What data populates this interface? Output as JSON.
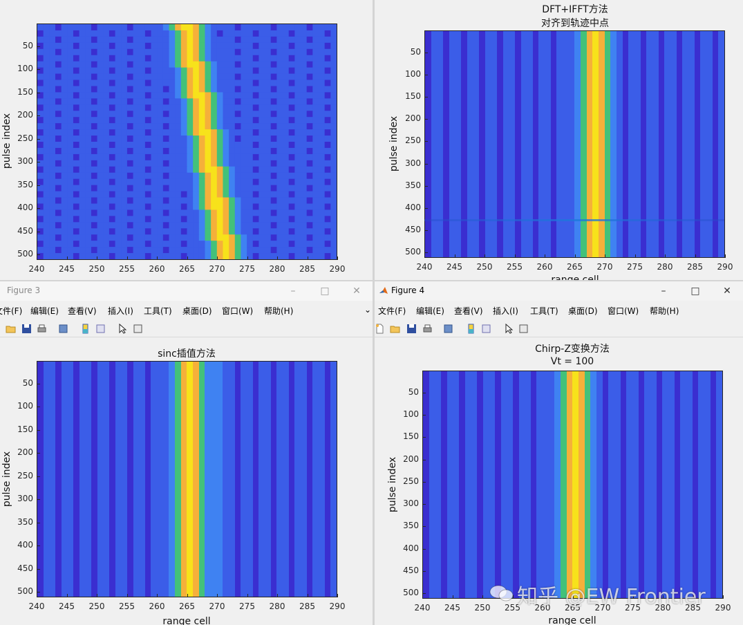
{
  "windows": {
    "fig1": {
      "title": "",
      "menu": []
    },
    "fig2": {
      "title": "",
      "menu": []
    },
    "fig3": {
      "title": "Figure 3",
      "menu": [
        "文件(F)",
        "编辑(E)",
        "查看(V)",
        "插入(I)",
        "工具(T)",
        "桌面(D)",
        "窗口(W)",
        "帮助(H)"
      ]
    },
    "fig4": {
      "title": "Figure 4",
      "menu": [
        "文件(F)",
        "编辑(E)",
        "查看(V)",
        "插入(I)",
        "工具(T)",
        "桌面(D)",
        "窗口(W)",
        "帮助(H)"
      ]
    }
  },
  "watermark": "知乎 @EW Frontier",
  "colors": {
    "dark_blue": "#3a2ed0",
    "blue": "#3b5de8",
    "light_blue": "#3f82f2",
    "cyan": "#1fb6c9",
    "green": "#43c17a",
    "yellow_green": "#a9c93a",
    "orange": "#f5b03a",
    "yellow": "#f7e21b"
  },
  "chart_data": [
    {
      "type": "heatmap",
      "id": "fig1",
      "title": "",
      "subtitle": "",
      "xlabel": "",
      "ylabel": "pulse index",
      "xlim": [
        240,
        290
      ],
      "ylim": [
        512,
        1
      ],
      "xticks": [
        "240",
        "245",
        "250",
        "255",
        "260",
        "265",
        "270",
        "275",
        "280",
        "285",
        "290"
      ],
      "yticks": [
        "50",
        "100",
        "150",
        "200",
        "250",
        "300",
        "350",
        "400",
        "450",
        "500"
      ],
      "peak_range_cell_start": 265,
      "peak_range_cell_end": 271.5
    },
    {
      "type": "heatmap",
      "id": "fig2",
      "title": "DFT+IFFT方法",
      "subtitle": "对齐到轨迹中点",
      "xlabel": "range cell",
      "ylabel": "pulse index",
      "xlim": [
        240,
        290
      ],
      "ylim": [
        512,
        1
      ],
      "xticks": [
        "240",
        "245",
        "250",
        "255",
        "260",
        "265",
        "270",
        "275",
        "280",
        "285",
        "290"
      ],
      "yticks": [
        "50",
        "100",
        "150",
        "200",
        "250",
        "300",
        "350",
        "400",
        "450",
        "500"
      ],
      "peak_range_cell": 268
    },
    {
      "type": "heatmap",
      "id": "fig3",
      "title": "sinc插值方法",
      "subtitle": "",
      "xlabel": "range cell",
      "ylabel": "pulse index",
      "xlim": [
        240,
        290
      ],
      "ylim": [
        512,
        1
      ],
      "xticks": [
        "240",
        "245",
        "250",
        "255",
        "260",
        "265",
        "270",
        "275",
        "280",
        "285",
        "290"
      ],
      "yticks": [
        "50",
        "100",
        "150",
        "200",
        "250",
        "300",
        "350",
        "400",
        "450",
        "500"
      ],
      "peak_range_cell": 265
    },
    {
      "type": "heatmap",
      "id": "fig4",
      "title": "Chirp-Z变换方法",
      "subtitle": "Vt = 100",
      "xlabel": "range cell",
      "ylabel": "pulse index",
      "xlim": [
        240,
        290
      ],
      "ylim": [
        512,
        1
      ],
      "xticks": [
        "240",
        "245",
        "250",
        "255",
        "260",
        "265",
        "270",
        "275",
        "280",
        "285",
        "290"
      ],
      "yticks": [
        "50",
        "100",
        "150",
        "200",
        "250",
        "300",
        "350",
        "400",
        "450",
        "500"
      ],
      "peak_range_cell": 265
    }
  ]
}
